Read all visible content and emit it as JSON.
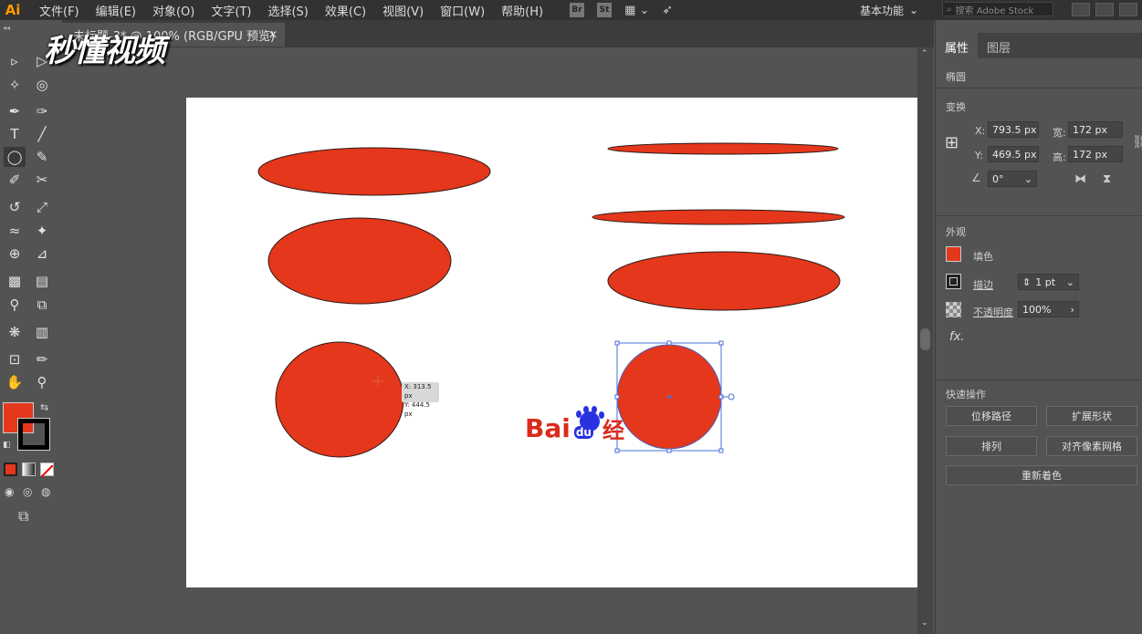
{
  "menubar": {
    "app_logo": "Ai",
    "items": [
      "文件(F)",
      "编辑(E)",
      "对象(O)",
      "文字(T)",
      "选择(S)",
      "效果(C)",
      "视图(V)",
      "窗口(W)",
      "帮助(H)"
    ],
    "bridge_icon": "Br",
    "stock_icon": "St",
    "workspace": "基本功能",
    "search_placeholder": "搜索 Adobe Stock"
  },
  "document": {
    "tab_title": "未标题-3* @ 100% (RGB/GPU 预览)",
    "close_glyph": "✕"
  },
  "watermark": "秒懂视频",
  "canvas": {
    "cursor_readout": {
      "x": "X: 313.5 px",
      "y": "Y: 444.5 px"
    },
    "logo_text": "Bai",
    "logo_paw_text": "du",
    "logo_suffix": "经",
    "fill_color": "#e4371b"
  },
  "panel": {
    "tabs": [
      "属性",
      "图层"
    ],
    "object_type": "椭圆",
    "transform_title": "变换",
    "x_label": "X:",
    "x_value": "793.5 px",
    "y_label": "Y:",
    "y_value": "469.5 px",
    "w_label": "宽:",
    "w_value": "172 px",
    "h_label": "高:",
    "h_value": "172 px",
    "angle_value": "0°",
    "appearance_title": "外观",
    "fill_label": "填色",
    "stroke_label": "描边",
    "stroke_value": "1 pt",
    "opacity_label": "不透明度",
    "opacity_value": "100%",
    "fx_label": "fx.",
    "quick_actions_title": "快速操作",
    "buttons": [
      "位移路径",
      "扩展形状",
      "排列",
      "对齐像素网格",
      "重新着色"
    ]
  }
}
